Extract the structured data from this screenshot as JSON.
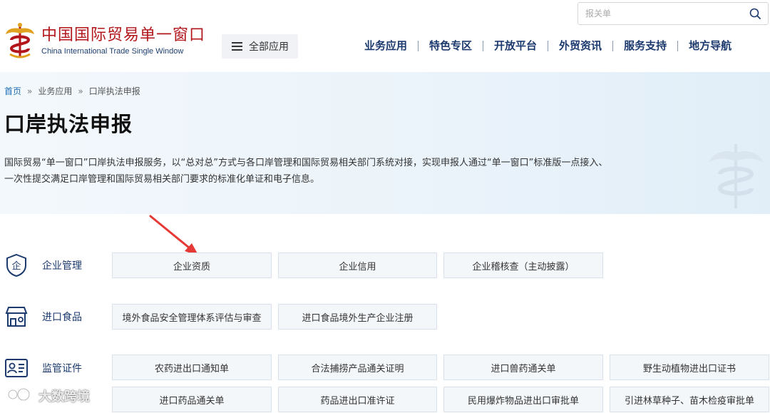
{
  "header": {
    "logo_cn": "中国国际贸易单一窗口",
    "logo_en": "China International Trade Single Window",
    "all_apps_label": "全部应用",
    "search_placeholder": "报关单",
    "nav": [
      "业务应用",
      "特色专区",
      "开放平台",
      "外贸资讯",
      "服务支持",
      "地方导航"
    ]
  },
  "breadcrumb": {
    "home": "首页",
    "level1": "业务应用",
    "current": "口岸执法申报",
    "separator": "»"
  },
  "page_title": "口岸执法申报",
  "description": [
    "国际贸易“单一窗口”口岸执法申报服务，以“总对总”方式与各口岸管理和国际贸易相关部门系统对接，实现申报人通过“单一窗口”标准版一点接入、",
    "一次性提交满足口岸管理和国际贸易相关部门要求的标准化单证和电子信息。"
  ],
  "categories": [
    {
      "label": "企业管理",
      "icon": "enterprise-shield-icon",
      "items": [
        "企业资质",
        "企业信用",
        "企业稽核查（主动披露）"
      ]
    },
    {
      "label": "进口食品",
      "icon": "food-store-icon",
      "items": [
        "境外食品安全管理体系评估与审查",
        "进口食品境外生产企业注册"
      ]
    },
    {
      "label": "监管证件",
      "icon": "id-card-icon",
      "items": [
        "农药进出口通知单",
        "合法捕捞产品通关证明",
        "进口兽药通关单",
        "野生动植物进出口证书",
        "进口药品通关单",
        "药品进出口准许证",
        "民用爆炸物品进出口审批单",
        "引进林草种子、苗木检疫审批单"
      ]
    }
  ],
  "watermark_text": "大数跨境",
  "colors": {
    "brand_red": "#b2161b",
    "nav_blue": "#1c3a6e",
    "link_blue": "#1e6eb5",
    "arrow_red": "#e53935",
    "banner_bg": "#eaf3fa",
    "button_bg": "#f4f7fa"
  }
}
